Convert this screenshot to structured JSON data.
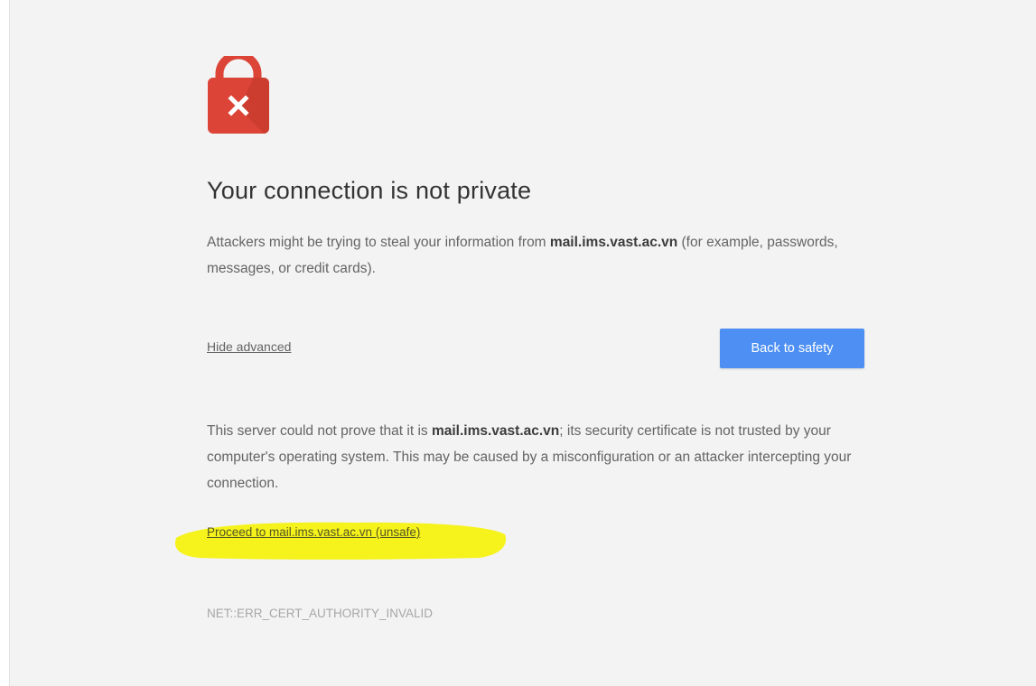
{
  "colors": {
    "page_background": "#f3f3f3",
    "lock_red": "#db4437",
    "button_blue": "#4d8ff2",
    "highlight_yellow": "#f4f20f"
  },
  "icon": "lock-error-icon",
  "heading": {
    "title": "Your connection is not private"
  },
  "intro": {
    "text_before": "Attackers might be trying to steal your information from ",
    "domain": "mail.ims.vast.ac.vn",
    "text_after": " (for example, passwords, messages, or credit cards)."
  },
  "controls": {
    "hide_advanced_label": "Hide advanced",
    "back_to_safety_label": "Back to safety"
  },
  "details": {
    "text_before": "This server could not prove that it is ",
    "domain": "mail.ims.vast.ac.vn",
    "text_after": "; its security certificate is not trusted by your computer's operating system. This may be caused by a misconfiguration or an attacker intercepting your connection."
  },
  "proceed": {
    "label": "Proceed to mail.ims.vast.ac.vn (unsafe)"
  },
  "error_code": "NET::ERR_CERT_AUTHORITY_INVALID"
}
